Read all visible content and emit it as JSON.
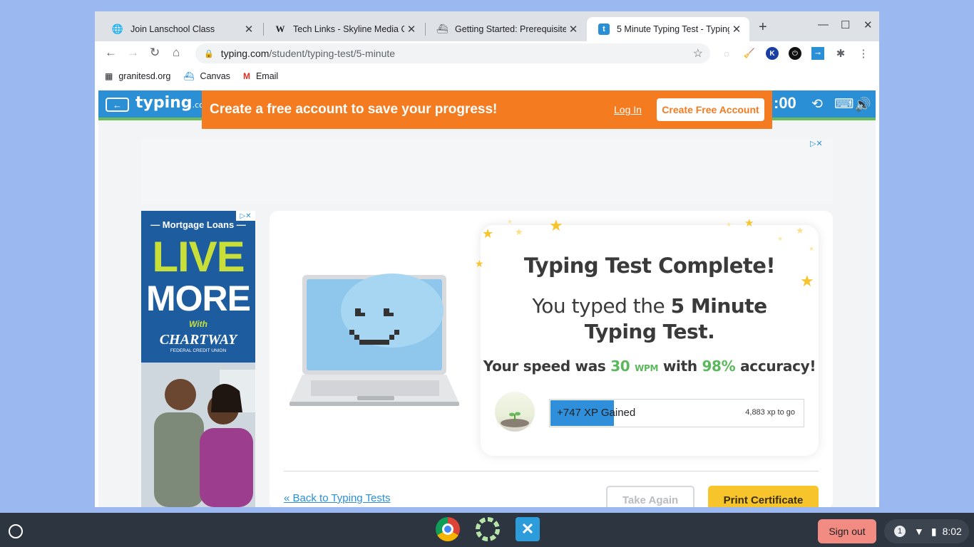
{
  "browser": {
    "tabs": [
      {
        "title": "Join Lanschool Class",
        "icon": "globe-icon"
      },
      {
        "title": "Tech Links - Skyline Media Cen",
        "icon": "wiki-icon"
      },
      {
        "title": "Getting Started: Prerequisites",
        "icon": "canvas-icon"
      },
      {
        "title": "5 Minute Typing Test - Typing",
        "icon": "typing-icon"
      }
    ],
    "new_tab": "+",
    "url_host": "typing.com",
    "url_path": "/student/typing-test/5-minute",
    "bookmarks": [
      {
        "label": "granitesd.org",
        "icon": "building-icon"
      },
      {
        "label": "Canvas",
        "icon": "canvas-icon"
      },
      {
        "label": "Email",
        "icon": "gmail-icon"
      }
    ]
  },
  "site": {
    "logo": "typing",
    "logo_suffix": ".com",
    "timer": ":00",
    "banner": {
      "text": "Create a free account to save your progress!",
      "login": "Log In",
      "create": "Create Free Account"
    }
  },
  "left_ad": {
    "line1": "— Mortgage Loans —",
    "line2": "LIVE",
    "line3": "MORE",
    "line4": "With",
    "line5": "CHARTWAY",
    "line6": "FEDERAL CREDIT UNION"
  },
  "result": {
    "title": "Typing Test Complete!",
    "sub_prefix": "You typed the ",
    "sub_bold": "5 Minute Typing Test.",
    "speed_prefix": "Your speed was ",
    "wpm": "30",
    "wpm_unit": "WPM",
    "speed_mid": " with ",
    "accuracy": "98%",
    "speed_suffix": " accuracy!",
    "xp_gained": "+747 XP Gained",
    "xp_to_go": "4,883 xp to go",
    "xp_progress": 0.25
  },
  "actions": {
    "back": "« Back to Typing Tests",
    "take_again": "Take Again",
    "print": "Print Certificate"
  },
  "shelf": {
    "sign_out": "Sign out",
    "notifications": "1",
    "time": "8:02"
  },
  "colors": {
    "accent": "#2b8fd6",
    "banner": "#f47b20",
    "green": "#5cb85c",
    "print": "#f7c52b"
  }
}
